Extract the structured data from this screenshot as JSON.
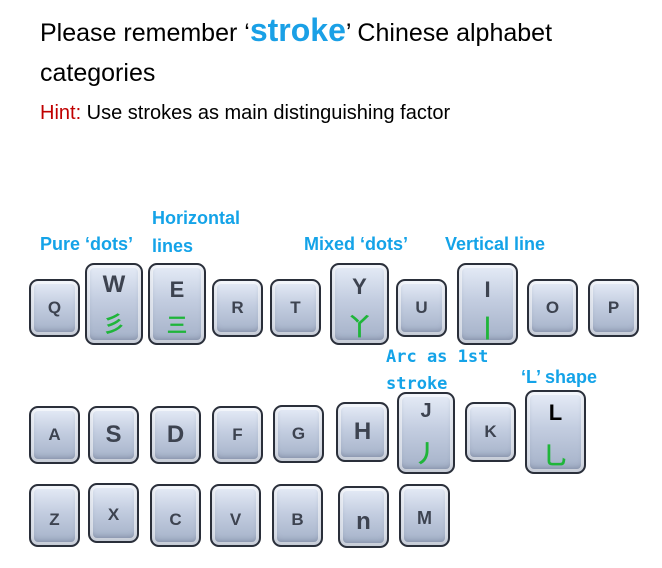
{
  "title": {
    "prefix": "Please remember ‘",
    "keyword": "stroke",
    "suffix": "’ Chinese alphabet categories"
  },
  "hint": {
    "label": "Hint:",
    "text": " Use strokes as main distinguishing factor"
  },
  "labels": {
    "pure_dots": "Pure ‘dots’",
    "horizontal_lines": "Horizontal lines",
    "mixed_dots": "Mixed ‘dots’",
    "vertical_line": "Vertical line",
    "arc_first_stroke": "Arc as 1st stroke",
    "l_shape": "‘L’ shape"
  },
  "keys": {
    "Q": "Q",
    "W": "W",
    "E": "E",
    "R": "R",
    "T": "T",
    "Y": "Y",
    "U": "U",
    "I": "I",
    "O": "O",
    "P": "P",
    "A": "A",
    "S": "S",
    "D": "D",
    "F": "F",
    "G": "G",
    "H": "H",
    "J": "J",
    "K": "K",
    "L": "L",
    "Z": "Z",
    "X": "X",
    "C": "C",
    "V": "V",
    "B": "B",
    "N": "n",
    "M": "M"
  },
  "chinese": {
    "W": "彡",
    "E": "三",
    "Y": "丫",
    "I": "丨",
    "J": "丿",
    "L": "乚"
  },
  "colors": {
    "accent": "#14a3e8",
    "hint_label": "#c00000",
    "stroke_green": "#1fb53a",
    "key_face": "#b9c4d9"
  }
}
